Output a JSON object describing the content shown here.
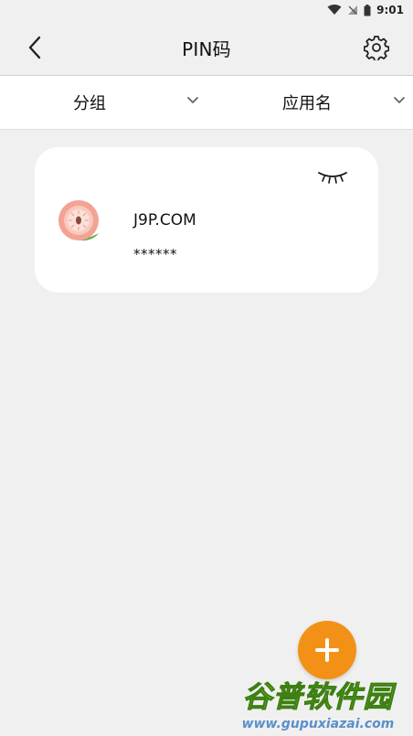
{
  "status_bar": {
    "time": "9:01"
  },
  "header": {
    "title": "PIN码"
  },
  "filters": {
    "group_label": "分组",
    "appname_label": "应用名"
  },
  "entries": [
    {
      "name": "J9P.COM",
      "pin": "******"
    }
  ],
  "watermark": {
    "text": "谷普软件园",
    "url": "www.gupuxiazai.com"
  },
  "colors": {
    "accent": "#f39117",
    "background": "#f0f0f0",
    "card": "#ffffff"
  }
}
